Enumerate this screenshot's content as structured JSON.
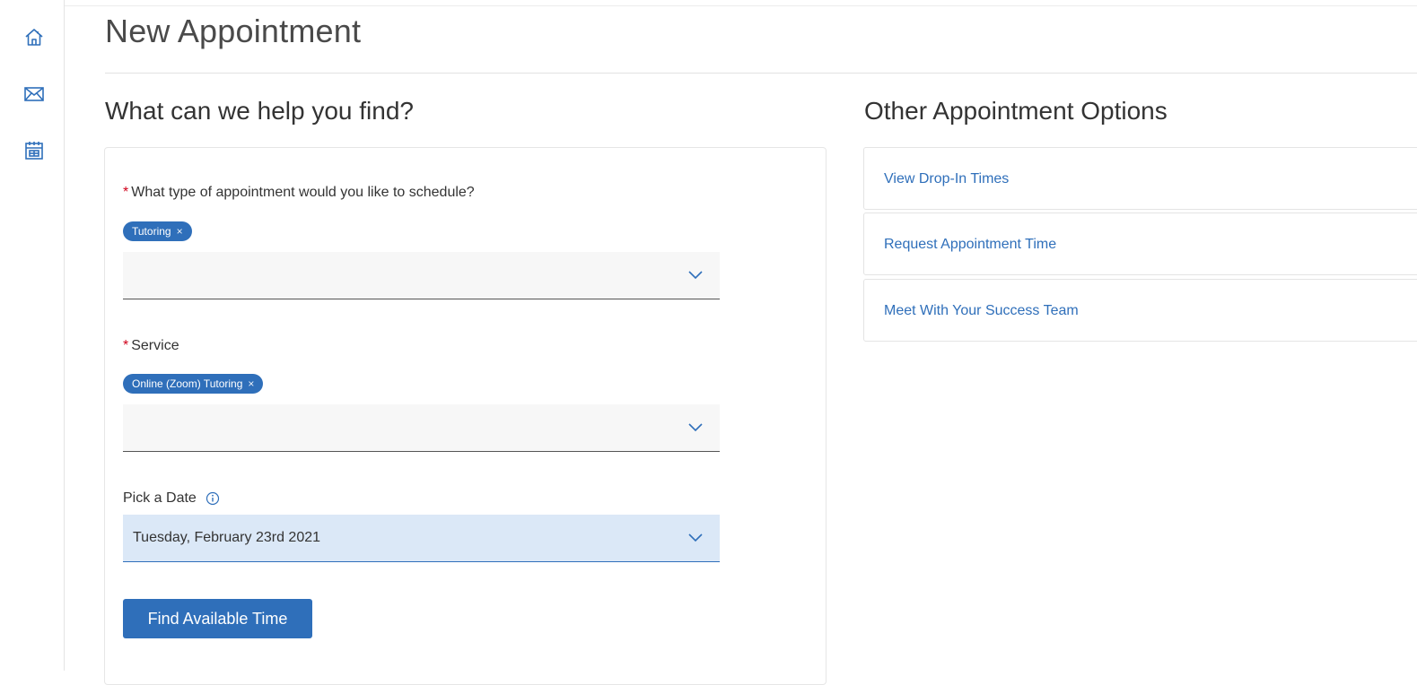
{
  "sidebar": {
    "items": [
      {
        "icon": "home-icon"
      },
      {
        "icon": "mail-icon"
      },
      {
        "icon": "calendar-icon"
      }
    ]
  },
  "page": {
    "title": "New Appointment"
  },
  "search": {
    "heading": "What can we help you find?",
    "appointment_type": {
      "label": "What type of appointment would you like to schedule?",
      "required_mark": "*",
      "selected_chip": "Tutoring",
      "chip_remove": "×"
    },
    "service": {
      "label": "Service",
      "required_mark": "*",
      "selected_chip": "Online (Zoom) Tutoring",
      "chip_remove": "×"
    },
    "date": {
      "label": "Pick a Date",
      "value": "Tuesday, February 23rd 2021"
    },
    "find_button": "Find Available Time"
  },
  "other_options": {
    "heading": "Other Appointment Options",
    "items": [
      {
        "label": "View Drop-In Times"
      },
      {
        "label": "Request Appointment Time"
      },
      {
        "label": "Meet With Your Success Team"
      }
    ]
  },
  "colors": {
    "accent": "#2f6fba",
    "required": "#d0021b",
    "date_field_bg": "#dbe8f7"
  }
}
